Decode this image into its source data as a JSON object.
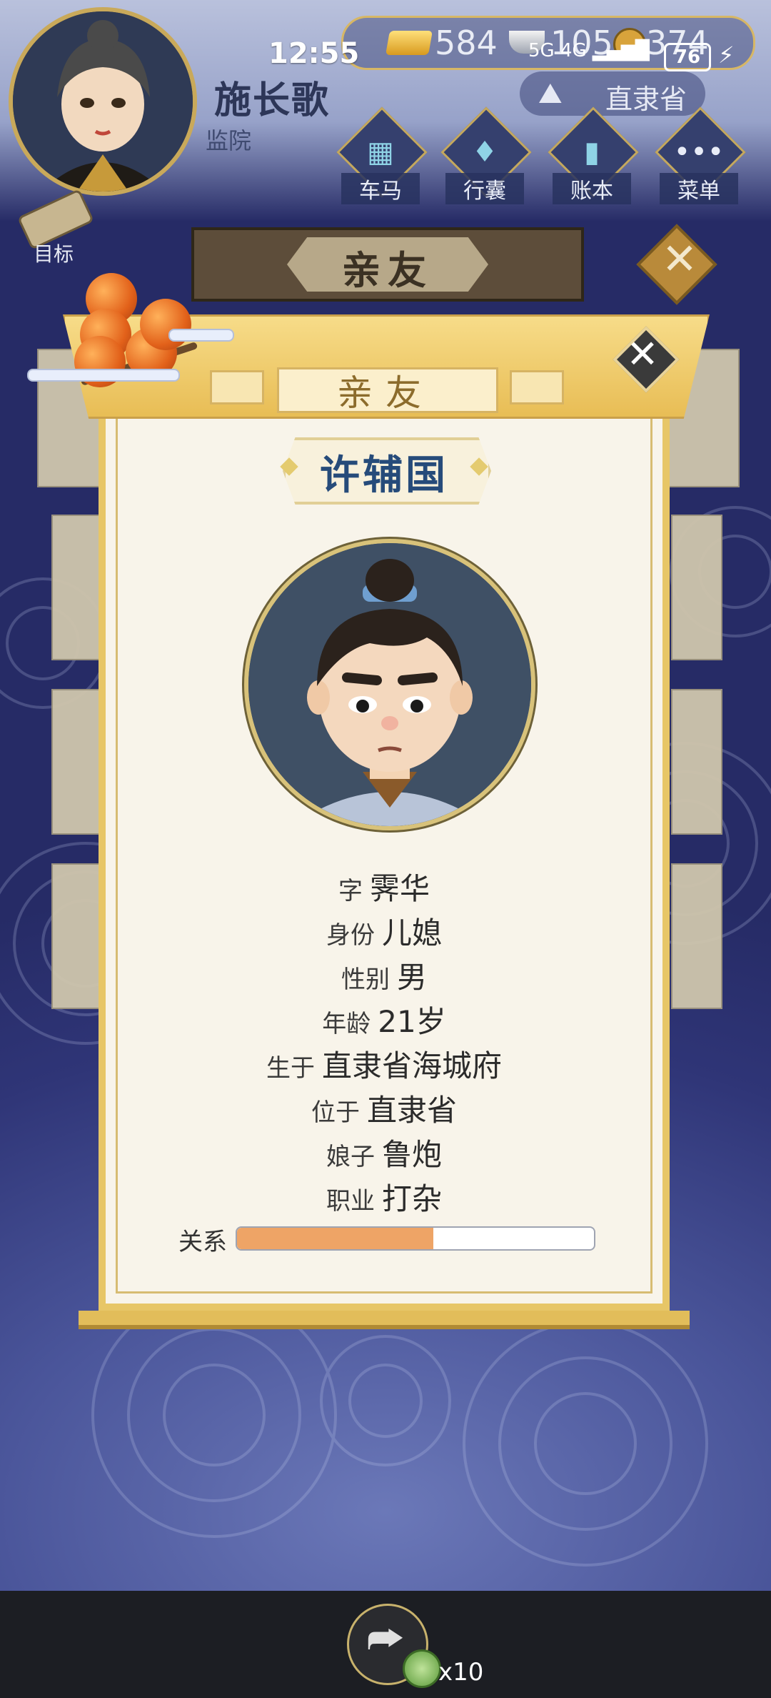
{
  "status_bar": {
    "time": "12:55",
    "network": "5G 4G",
    "battery": "76"
  },
  "player": {
    "name": "施长歌",
    "title": "监院"
  },
  "currency": {
    "gold": "584",
    "silver": "105",
    "coins": "374"
  },
  "region": {
    "label": "直隶省"
  },
  "nav": {
    "carriage": "车马",
    "luggage": "行囊",
    "ledger": "账本",
    "menu": "菜单"
  },
  "goal": {
    "label": "目标"
  },
  "page_title": "亲友",
  "modal": {
    "title": "亲友",
    "person_name": "许辅国",
    "fields": [
      {
        "key": "字",
        "value": "霁华"
      },
      {
        "key": "身份",
        "value": "儿媳"
      },
      {
        "key": "性别",
        "value": "男"
      },
      {
        "key": "年龄",
        "value": "21岁"
      },
      {
        "key": "生于",
        "value": "直隶省海城府"
      },
      {
        "key": "位于",
        "value": "直隶省"
      },
      {
        "key": "娘子",
        "value": "鲁炮"
      },
      {
        "key": "职业",
        "value": "打杂"
      }
    ],
    "relation_label": "关系",
    "relation_level": 0.55
  },
  "bottom": {
    "reward_count": "x10"
  },
  "colors": {
    "accent_gold": "#e7c667",
    "name_blue": "#264b7a",
    "relation_fill": "#eea466"
  }
}
